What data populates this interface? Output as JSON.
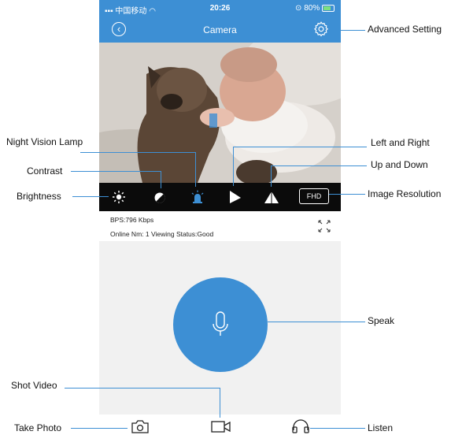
{
  "status_bar": {
    "carrier": "中国移动",
    "time": "20:26",
    "battery": "80%"
  },
  "navbar": {
    "title": "Camera",
    "back_icon": "chevron-left-icon",
    "settings_icon": "gear-icon"
  },
  "toolbar": {
    "brightness_icon": "sun-icon",
    "contrast_icon": "contrast-icon",
    "night_lamp_icon": "alarm-lamp-icon",
    "left_right_icon": "triangle-right-icon",
    "up_down_icon": "triangle-up-icon",
    "resolution": "FHD"
  },
  "info": {
    "bps": "BPS:796 Kbps",
    "online": "Online Nm: 1  Viewing Status:Good"
  },
  "bottom_bar": {
    "photo_icon": "camera-icon",
    "video_icon": "video-camera-icon",
    "listen_icon": "headphones-icon"
  },
  "callouts": {
    "advanced_setting": "Advanced Setting",
    "night_vision_lamp": "Night Vision Lamp",
    "left_and_right": "Left and Right",
    "contrast": "Contrast",
    "up_and_down": "Up and Down",
    "brightness": "Brightness",
    "image_resolution": "Image Resolution",
    "speak": "Speak",
    "shot_video": "Shot Video",
    "take_photo": "Take Photo",
    "listen": "Listen"
  },
  "colors": {
    "accent": "#3d8fd4",
    "toolbar_bg": "#0b0b0b",
    "talk_bg": "#f1f1f1"
  }
}
